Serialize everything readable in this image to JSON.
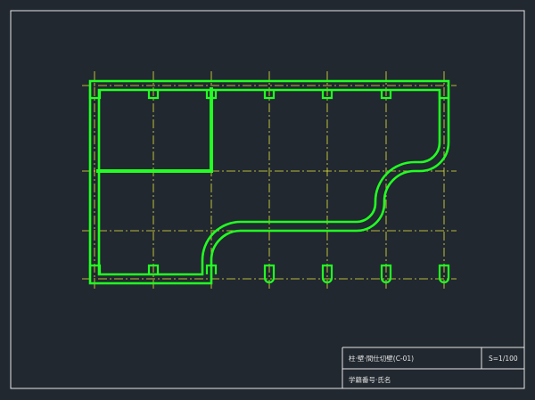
{
  "drawing": {
    "background_color": "#212830",
    "frame_color": "#e6e6e6",
    "wall_color": "#22ff22",
    "grid_line_color": "#e8e83a",
    "grid_line_style": "dash-dot"
  },
  "title_block": {
    "drawing_title": "柱·壁·間仕切壁(C-01)",
    "scale": "S=1/100",
    "student_info": "学籍番号·氏名"
  }
}
